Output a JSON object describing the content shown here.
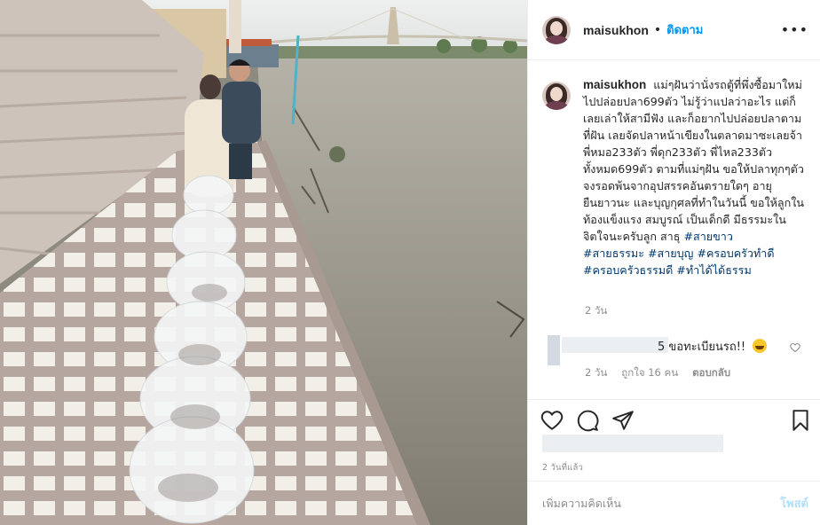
{
  "header": {
    "username": "maisukhon",
    "separator": "•",
    "follow_label": "ติดตาม",
    "more_label": "•••"
  },
  "caption": {
    "username": "maisukhon",
    "text": "แม่ๆฝันว่านั่งรถตู้ที่พึ่งซื้อมาใหม่ไปปล่อยปลา699ตัว ไม่รู้ว่าแปลว่าอะไร แต่ก็เลยเล่าให้สามีฟัง และก็อยากไปปล่อยปลาตามที่ฝัน เลยจัดปลาหน้าเขียงในตลาดมาซะเลยจ้า พี่หมอ233ตัว พี่ดุก233ตัว พี่ไหล233ตัว ทั้งหมด699ตัว ตามที่แม่ๆฝัน ขอให้ปลาทุกๆตัวจงรอดพ้นจากอุปสรรคอันตรายใดๆ อายุยืนยาวนะ และบุญกุศลที่ทำในวันนี้ ขอให้ลูกในท้องแข็งแรง สมบูรณ์ เป็นเด็กดี มีธรรมะในจิตใจนะครับลูก สาธุ",
    "tags": [
      "#สายขาว",
      "#สายธรรมะ",
      "#สายบุญ",
      "#ครอบครัวทำดี",
      "#ครอบครัวธรรมดี",
      "#ทำได้ได้ธรรม"
    ],
    "time": "2 วัน"
  },
  "comment": {
    "text_visible": "5 ขอทะเบียนรถ!!",
    "emoji": "grinning-face",
    "time": "2 วัน",
    "likes": "ถูกใจ 16 คน",
    "reply": "ตอบกลับ"
  },
  "actions": {
    "like_icon": "heart-outline-icon",
    "comment_icon": "speech-bubble-icon",
    "share_icon": "paper-plane-icon",
    "save_icon": "bookmark-icon"
  },
  "post_time": "2 วันที่แล้ว",
  "add_comment": {
    "placeholder": "เพิ่มความคิดเห็น",
    "post_label": "โพสต์"
  },
  "colors": {
    "link_blue": "#0095f6",
    "hashtag": "#00376b",
    "muted": "#8e8e8e",
    "post_disabled": "#b2dffc",
    "river": "#9c978a"
  }
}
